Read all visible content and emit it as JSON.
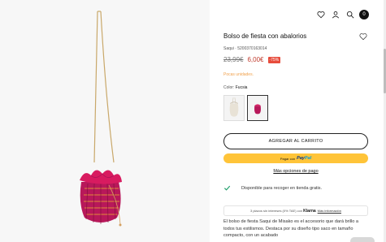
{
  "header": {
    "icons": [
      "heart-icon",
      "user-icon",
      "search-icon",
      "cart-icon"
    ],
    "cart_count": "0"
  },
  "product": {
    "title": "Bolso de fiesta con abalorios",
    "sku": "Saqui · 5200370163014",
    "old_price": "23,99€",
    "new_price": "6,00€",
    "discount": "-75%",
    "stock_note": "Pocas unidades.",
    "color_label": "Color: ",
    "color_value": "Fucsia"
  },
  "actions": {
    "add_to_cart": "AGREGAR AL CARRITO",
    "paypal_prefix": "Pagar con",
    "paypal_brand_1": "Pay",
    "paypal_brand_2": "Pal",
    "more_payment": "Más opciones de pago"
  },
  "pickup": {
    "text": "Disponible para recoger en tienda gratis."
  },
  "klarna": {
    "prefix": "3 plazos sin intereses (0% TAE) con",
    "brand": "Klarna",
    "link": "Más información"
  },
  "description": {
    "text": "El bolso de fiesta Saqui de Misako es el accesorio que dará brillo a todos tus estilismos. Destaca por su diseño tipo saco en tamaño compacto, con un acabado"
  },
  "colors": {
    "accent_red": "#e74c3c",
    "stock_orange": "#f0a04b",
    "paypal_yellow": "#ffc439",
    "bag_fuchsia": "#c2185b"
  }
}
